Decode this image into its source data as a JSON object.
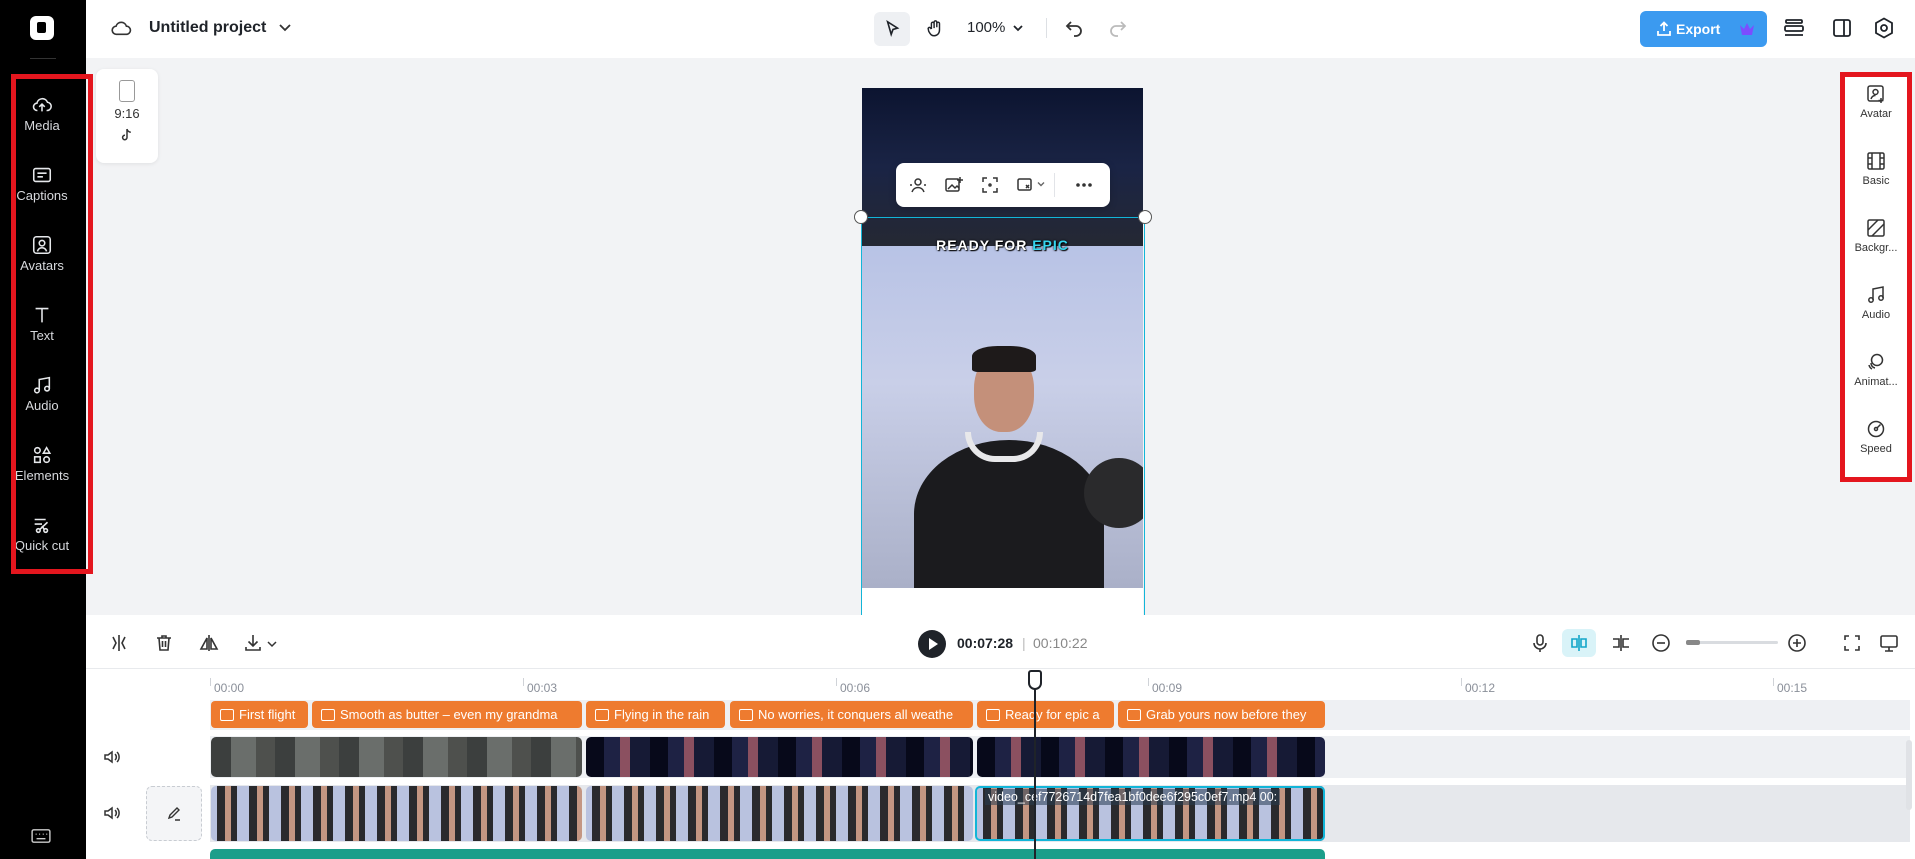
{
  "app": {
    "project_title": "Untitled project",
    "zoom": "100%",
    "export_label": "Export"
  },
  "left_nav": [
    {
      "label": "Media",
      "icon": "cloud-upload-icon"
    },
    {
      "label": "Captions",
      "icon": "captions-icon"
    },
    {
      "label": "Avatars",
      "icon": "avatar-icon"
    },
    {
      "label": "Text",
      "icon": "text-icon"
    },
    {
      "label": "Audio",
      "icon": "music-note-icon"
    },
    {
      "label": "Elements",
      "icon": "elements-icon"
    },
    {
      "label": "Quick cut",
      "icon": "scissors-icon"
    }
  ],
  "ratio_card": {
    "ratio": "9:16",
    "platform_icon": "tiktok-icon"
  },
  "canvas": {
    "caption_prefix": "READY FOR ",
    "caption_highlight": "EPIC"
  },
  "right_panel": [
    {
      "label": "Avatar",
      "icon": "avatar-add-icon"
    },
    {
      "label": "Basic",
      "icon": "film-icon"
    },
    {
      "label": "Backgr...",
      "icon": "background-icon"
    },
    {
      "label": "Audio",
      "icon": "music-note-icon"
    },
    {
      "label": "Animat...",
      "icon": "animation-icon"
    },
    {
      "label": "Speed",
      "icon": "speed-icon"
    }
  ],
  "playback": {
    "current_time": "00:07:28",
    "separator": "|",
    "total_time": "00:10:22"
  },
  "ruler": [
    "00:00",
    "00:03",
    "00:06",
    "00:09",
    "00:12",
    "00:15"
  ],
  "captions": [
    "First flight",
    "Smooth as butter – even my grandma",
    "Flying in the rain",
    "No worries, it conquers all weathe",
    "Ready for epic a",
    "Grab yours now before they"
  ],
  "video_clip_label": "video_cef7726714d7fea1bf0dee6f295c0ef7.mp4",
  "video_clip_duration": "00:",
  "colors": {
    "accent": "#12b5d8",
    "export": "#3b9af0",
    "caption_clip": "#ee7b2f",
    "highlight_box": "#e4161e"
  }
}
